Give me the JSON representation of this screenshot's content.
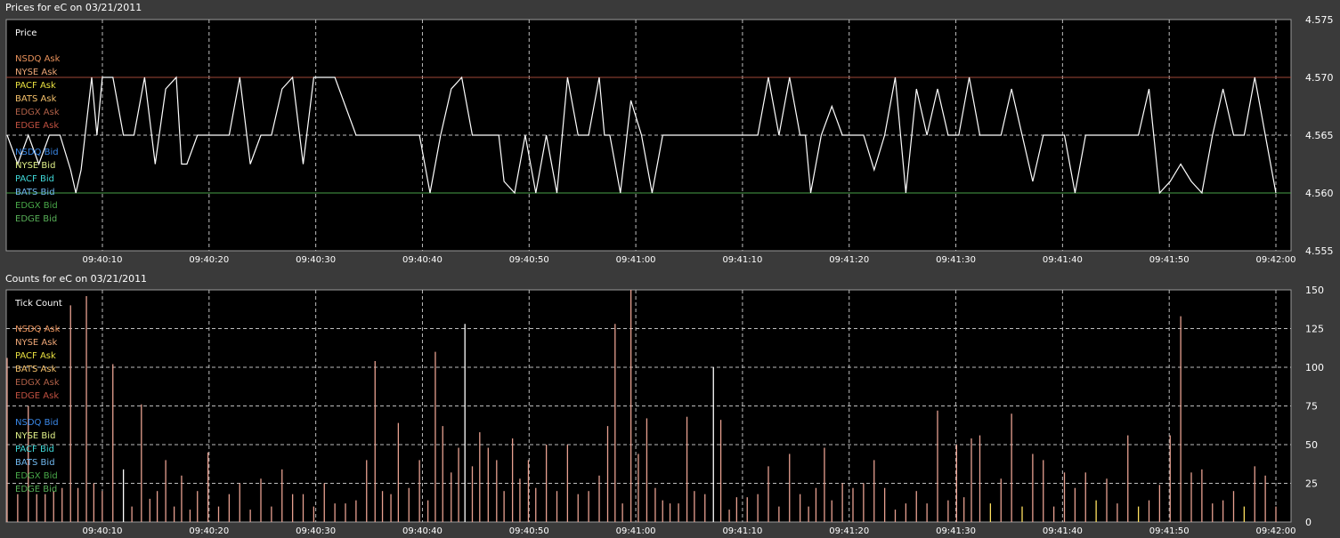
{
  "top_panel": {
    "title": "Prices for  eC  on  03/21/2011"
  },
  "bottom_panel": {
    "title": "Counts for  eC  on  03/21/2011"
  },
  "legend": [
    {
      "label": "NSDQ Ask",
      "color": "#e8915a"
    },
    {
      "label": "NYSE Ask",
      "color": "#f0a878"
    },
    {
      "label": "PACF Ask",
      "color": "#e8e040"
    },
    {
      "label": "BATS Ask",
      "color": "#f4c06a"
    },
    {
      "label": "EDGX Ask",
      "color": "#b06048"
    },
    {
      "label": "EDGE Ask",
      "color": "#c05040"
    },
    {
      "label": "NSDQ Bid",
      "color": "#3a88e8"
    },
    {
      "label": "NYSE Bid",
      "color": "#e0f088"
    },
    {
      "label": "PACF Bid",
      "color": "#40d8d8"
    },
    {
      "label": "BATS Bid",
      "color": "#70b8f0"
    },
    {
      "label": "EDGX Bid",
      "color": "#48a848"
    },
    {
      "label": "EDGE Bid",
      "color": "#58b058"
    }
  ],
  "chart_data": [
    {
      "type": "line",
      "title": "Prices for  eC  on  03/21/2011",
      "panel_label": "Price",
      "x_ticks": [
        "09:40:10",
        "09:40:20",
        "09:40:30",
        "09:40:40",
        "09:40:50",
        "09:41:00",
        "09:41:10",
        "09:41:20",
        "09:41:30",
        "09:41:40",
        "09:41:50",
        "09:42:00"
      ],
      "y_ticks": [
        "4.575",
        "4.570",
        "4.565",
        "4.560",
        "4.555"
      ],
      "x_range_seconds": [
        0,
        120
      ],
      "ylim": [
        4.555,
        4.575
      ],
      "grid": true,
      "legend_position": "left",
      "ask_line": {
        "value": 4.57,
        "color": "#a04838"
      },
      "bid_line": {
        "value": 4.56,
        "color": "#48a048"
      },
      "series": [
        {
          "color": "#ffffff",
          "x": [
            0,
            1,
            2,
            3,
            4,
            5,
            6,
            6.5,
            7,
            8,
            8.5,
            9,
            10,
            11,
            12,
            13,
            14,
            15,
            16,
            16.5,
            17,
            18,
            19,
            20,
            21,
            22,
            23,
            24,
            25,
            26,
            27,
            28,
            29,
            30,
            31,
            32,
            33,
            34,
            35,
            36,
            37,
            38,
            39,
            40,
            41,
            42,
            43,
            44,
            45,
            46,
            46.5,
            47,
            48,
            49,
            50,
            51,
            52,
            53,
            54,
            55,
            56,
            56.5,
            57,
            58,
            59,
            60,
            61,
            62,
            63,
            64,
            65,
            66,
            67,
            68,
            69,
            70,
            71,
            72,
            73,
            74,
            75,
            75.5,
            76,
            77,
            78,
            79,
            80,
            81,
            82,
            83,
            84,
            85,
            86,
            87,
            88,
            89,
            90,
            91,
            92,
            93,
            94,
            95,
            96,
            97,
            98,
            99,
            100,
            101,
            102,
            103,
            104,
            105,
            106,
            107,
            108,
            109,
            110,
            111,
            112,
            113,
            114,
            115,
            116,
            117,
            118,
            119,
            120
          ],
          "y": [
            4.565,
            4.5625,
            4.565,
            4.5625,
            4.565,
            4.565,
            4.562,
            4.56,
            4.562,
            4.57,
            4.565,
            4.57,
            4.57,
            4.565,
            4.565,
            4.57,
            4.5625,
            4.569,
            4.57,
            4.5625,
            4.5625,
            4.565,
            4.565,
            4.565,
            4.565,
            4.57,
            4.5625,
            4.565,
            4.565,
            4.569,
            4.57,
            4.5625,
            4.57,
            4.57,
            4.57,
            4.5675,
            4.565,
            4.565,
            4.565,
            4.565,
            4.565,
            4.565,
            4.565,
            4.56,
            4.565,
            4.569,
            4.57,
            4.565,
            4.565,
            4.565,
            4.565,
            4.561,
            4.56,
            4.565,
            4.56,
            4.565,
            4.56,
            4.57,
            4.565,
            4.565,
            4.57,
            4.565,
            4.565,
            4.56,
            4.568,
            4.565,
            4.56,
            4.565,
            4.565,
            4.565,
            4.565,
            4.565,
            4.565,
            4.565,
            4.565,
            4.565,
            4.565,
            4.57,
            4.565,
            4.57,
            4.565,
            4.565,
            4.56,
            4.565,
            4.5675,
            4.565,
            4.565,
            4.565,
            4.562,
            4.565,
            4.57,
            4.56,
            4.569,
            4.565,
            4.569,
            4.565,
            4.565,
            4.57,
            4.565,
            4.565,
            4.565,
            4.569,
            4.565,
            4.561,
            4.565,
            4.565,
            4.565,
            4.56,
            4.565,
            4.565,
            4.565,
            4.565,
            4.565,
            4.565,
            4.569,
            4.56,
            4.561,
            4.5625,
            4.561,
            4.56,
            4.565,
            4.569,
            4.565,
            4.565,
            4.57,
            4.565,
            4.56
          ]
        }
      ]
    },
    {
      "type": "bar",
      "title": "Counts for  eC  on  03/21/2011",
      "panel_label": "Tick Count",
      "x_ticks": [
        "09:40:10",
        "09:40:20",
        "09:40:30",
        "09:40:40",
        "09:40:50",
        "09:41:00",
        "09:41:10",
        "09:41:20",
        "09:41:30",
        "09:41:40",
        "09:41:50",
        "09:42:00"
      ],
      "y_ticks": [
        "150",
        "125",
        "100",
        "75",
        "50",
        "25",
        "0"
      ],
      "x_range_seconds": [
        0,
        120
      ],
      "ylim": [
        0,
        150
      ],
      "grid": true,
      "legend_position": "left",
      "bars": [
        {
          "x": 0.0,
          "v": 106,
          "c": "#e8a090"
        },
        {
          "x": 1.0,
          "v": 18,
          "c": "#e8a090"
        },
        {
          "x": 2.0,
          "v": 75,
          "c": "#e8a090"
        },
        {
          "x": 2.8,
          "v": 18,
          "c": "#e8a090"
        },
        {
          "x": 3.6,
          "v": 18,
          "c": "#e8a090"
        },
        {
          "x": 4.4,
          "v": 20,
          "c": "#e8a090"
        },
        {
          "x": 5.2,
          "v": 22,
          "c": "#e8a090"
        },
        {
          "x": 6.0,
          "v": 140,
          "c": "#e8a090"
        },
        {
          "x": 6.7,
          "v": 22,
          "c": "#e8a090"
        },
        {
          "x": 7.5,
          "v": 146,
          "c": "#e8a090"
        },
        {
          "x": 8.2,
          "v": 25,
          "c": "#e8a090"
        },
        {
          "x": 9.0,
          "v": 20,
          "c": "#e8a090"
        },
        {
          "x": 10.0,
          "v": 102,
          "c": "#e8a090"
        },
        {
          "x": 11.0,
          "v": 34,
          "c": "#ffffff"
        },
        {
          "x": 11.8,
          "v": 10,
          "c": "#e8a090"
        },
        {
          "x": 12.7,
          "v": 76,
          "c": "#e8a090"
        },
        {
          "x": 13.5,
          "v": 15,
          "c": "#e8a090"
        },
        {
          "x": 14.2,
          "v": 20,
          "c": "#e8a090"
        },
        {
          "x": 15.0,
          "v": 40,
          "c": "#e8a090"
        },
        {
          "x": 15.8,
          "v": 10,
          "c": "#e8a090"
        },
        {
          "x": 16.5,
          "v": 30,
          "c": "#e8a090"
        },
        {
          "x": 17.3,
          "v": 8,
          "c": "#e8a090"
        },
        {
          "x": 18.0,
          "v": 20,
          "c": "#e8a090"
        },
        {
          "x": 19.0,
          "v": 45,
          "c": "#e8a090"
        },
        {
          "x": 20.0,
          "v": 10,
          "c": "#e8a090"
        },
        {
          "x": 21.0,
          "v": 18,
          "c": "#e8a090"
        },
        {
          "x": 22.0,
          "v": 25,
          "c": "#e8a090"
        },
        {
          "x": 23.0,
          "v": 8,
          "c": "#e8a090"
        },
        {
          "x": 24.0,
          "v": 28,
          "c": "#e8a090"
        },
        {
          "x": 25.0,
          "v": 10,
          "c": "#e8a090"
        },
        {
          "x": 26.0,
          "v": 34,
          "c": "#e8a090"
        },
        {
          "x": 27.0,
          "v": 18,
          "c": "#e8a090"
        },
        {
          "x": 28.0,
          "v": 18,
          "c": "#e8a090"
        },
        {
          "x": 29.0,
          "v": 10,
          "c": "#e8a090"
        },
        {
          "x": 30.0,
          "v": 25,
          "c": "#e8a090"
        },
        {
          "x": 31.0,
          "v": 12,
          "c": "#e8a090"
        },
        {
          "x": 32.0,
          "v": 12,
          "c": "#e8a090"
        },
        {
          "x": 33.0,
          "v": 14,
          "c": "#e8a090"
        },
        {
          "x": 34.0,
          "v": 40,
          "c": "#e8a090"
        },
        {
          "x": 34.8,
          "v": 104,
          "c": "#e8a090"
        },
        {
          "x": 35.5,
          "v": 20,
          "c": "#e8a090"
        },
        {
          "x": 36.3,
          "v": 18,
          "c": "#e8a090"
        },
        {
          "x": 37.0,
          "v": 64,
          "c": "#e8a090"
        },
        {
          "x": 38.0,
          "v": 22,
          "c": "#e8a090"
        },
        {
          "x": 39.0,
          "v": 40,
          "c": "#e8a090"
        },
        {
          "x": 39.8,
          "v": 14,
          "c": "#e8a090"
        },
        {
          "x": 40.5,
          "v": 110,
          "c": "#e8a090"
        },
        {
          "x": 41.2,
          "v": 62,
          "c": "#e8a090"
        },
        {
          "x": 42.0,
          "v": 32,
          "c": "#e8a090"
        },
        {
          "x": 42.7,
          "v": 48,
          "c": "#e8a090"
        },
        {
          "x": 43.3,
          "v": 128,
          "c": "#ffffff"
        },
        {
          "x": 44.0,
          "v": 36,
          "c": "#e8a090"
        },
        {
          "x": 44.7,
          "v": 58,
          "c": "#e8a090"
        },
        {
          "x": 45.5,
          "v": 48,
          "c": "#e8a090"
        },
        {
          "x": 46.3,
          "v": 40,
          "c": "#e8a090"
        },
        {
          "x": 47.0,
          "v": 20,
          "c": "#e8a090"
        },
        {
          "x": 47.8,
          "v": 54,
          "c": "#e8a090"
        },
        {
          "x": 48.5,
          "v": 28,
          "c": "#e8a090"
        },
        {
          "x": 49.3,
          "v": 40,
          "c": "#e8a090"
        },
        {
          "x": 50.0,
          "v": 22,
          "c": "#e8a090"
        },
        {
          "x": 51.0,
          "v": 50,
          "c": "#e8a090"
        },
        {
          "x": 52.0,
          "v": 20,
          "c": "#e8a090"
        },
        {
          "x": 53.0,
          "v": 50,
          "c": "#e8a090"
        },
        {
          "x": 54.0,
          "v": 18,
          "c": "#e8a090"
        },
        {
          "x": 55.0,
          "v": 20,
          "c": "#e8a090"
        },
        {
          "x": 56.0,
          "v": 30,
          "c": "#e8a090"
        },
        {
          "x": 56.8,
          "v": 62,
          "c": "#e8a090"
        },
        {
          "x": 57.5,
          "v": 128,
          "c": "#e8a090"
        },
        {
          "x": 58.2,
          "v": 12,
          "c": "#e8a090"
        },
        {
          "x": 59.0,
          "v": 150,
          "c": "#e8a090"
        },
        {
          "x": 59.7,
          "v": 44,
          "c": "#e8a090"
        },
        {
          "x": 60.5,
          "v": 67,
          "c": "#e8a090"
        },
        {
          "x": 61.3,
          "v": 22,
          "c": "#e8a090"
        },
        {
          "x": 62.0,
          "v": 14,
          "c": "#e8a090"
        },
        {
          "x": 62.7,
          "v": 12,
          "c": "#e8a090"
        },
        {
          "x": 63.5,
          "v": 12,
          "c": "#e8a090"
        },
        {
          "x": 64.3,
          "v": 68,
          "c": "#e8a090"
        },
        {
          "x": 65.0,
          "v": 20,
          "c": "#e8a090"
        },
        {
          "x": 66.0,
          "v": 18,
          "c": "#e8a090"
        },
        {
          "x": 66.8,
          "v": 100,
          "c": "#ffffff"
        },
        {
          "x": 67.5,
          "v": 66,
          "c": "#e8a090"
        },
        {
          "x": 68.3,
          "v": 8,
          "c": "#e8a090"
        },
        {
          "x": 69.0,
          "v": 16,
          "c": "#e8a090"
        },
        {
          "x": 70.0,
          "v": 16,
          "c": "#e8a090"
        },
        {
          "x": 71.0,
          "v": 18,
          "c": "#e8a090"
        },
        {
          "x": 72.0,
          "v": 36,
          "c": "#e8a090"
        },
        {
          "x": 73.0,
          "v": 10,
          "c": "#e8a090"
        },
        {
          "x": 74.0,
          "v": 44,
          "c": "#e8a090"
        },
        {
          "x": 75.0,
          "v": 18,
          "c": "#e8a090"
        },
        {
          "x": 75.8,
          "v": 10,
          "c": "#e8a090"
        },
        {
          "x": 76.5,
          "v": 22,
          "c": "#e8a090"
        },
        {
          "x": 77.3,
          "v": 48,
          "c": "#e8a090"
        },
        {
          "x": 78.0,
          "v": 14,
          "c": "#e8a090"
        },
        {
          "x": 79.0,
          "v": 25,
          "c": "#e8a090"
        },
        {
          "x": 80.0,
          "v": 22,
          "c": "#e8a090"
        },
        {
          "x": 81.0,
          "v": 25,
          "c": "#e8a090"
        },
        {
          "x": 82.0,
          "v": 40,
          "c": "#e8a090"
        },
        {
          "x": 83.0,
          "v": 22,
          "c": "#e8a090"
        },
        {
          "x": 84.0,
          "v": 8,
          "c": "#e8a090"
        },
        {
          "x": 85.0,
          "v": 12,
          "c": "#e8a090"
        },
        {
          "x": 86.0,
          "v": 20,
          "c": "#e8a090"
        },
        {
          "x": 87.0,
          "v": 12,
          "c": "#e8a090"
        },
        {
          "x": 88.0,
          "v": 72,
          "c": "#e8a090"
        },
        {
          "x": 89.0,
          "v": 14,
          "c": "#e8a090"
        },
        {
          "x": 89.8,
          "v": 50,
          "c": "#e8a090"
        },
        {
          "x": 90.5,
          "v": 16,
          "c": "#e8a090"
        },
        {
          "x": 91.2,
          "v": 54,
          "c": "#e8a090"
        },
        {
          "x": 92.0,
          "v": 56,
          "c": "#e8a090"
        },
        {
          "x": 93.0,
          "v": 12,
          "c": "#ffe060"
        },
        {
          "x": 94.0,
          "v": 28,
          "c": "#e8a090"
        },
        {
          "x": 95.0,
          "v": 70,
          "c": "#e8a090"
        },
        {
          "x": 96.0,
          "v": 10,
          "c": "#ffe060"
        },
        {
          "x": 97.0,
          "v": 44,
          "c": "#e8a090"
        },
        {
          "x": 98.0,
          "v": 40,
          "c": "#e8a090"
        },
        {
          "x": 99.0,
          "v": 10,
          "c": "#e8a090"
        },
        {
          "x": 100.0,
          "v": 32,
          "c": "#e8a090"
        },
        {
          "x": 101.0,
          "v": 22,
          "c": "#e8a090"
        },
        {
          "x": 102.0,
          "v": 32,
          "c": "#e8a090"
        },
        {
          "x": 103.0,
          "v": 14,
          "c": "#ffe060"
        },
        {
          "x": 104.0,
          "v": 28,
          "c": "#e8a090"
        },
        {
          "x": 105.0,
          "v": 12,
          "c": "#e8a090"
        },
        {
          "x": 106.0,
          "v": 56,
          "c": "#e8a090"
        },
        {
          "x": 107.0,
          "v": 10,
          "c": "#ffe060"
        },
        {
          "x": 108.0,
          "v": 14,
          "c": "#e8a090"
        },
        {
          "x": 109.0,
          "v": 24,
          "c": "#e8a090"
        },
        {
          "x": 110.0,
          "v": 56,
          "c": "#e8a090"
        },
        {
          "x": 111.0,
          "v": 133,
          "c": "#e8a090"
        },
        {
          "x": 112.0,
          "v": 32,
          "c": "#e8a090"
        },
        {
          "x": 113.0,
          "v": 34,
          "c": "#e8a090"
        },
        {
          "x": 114.0,
          "v": 12,
          "c": "#e8a090"
        },
        {
          "x": 115.0,
          "v": 14,
          "c": "#e8a090"
        },
        {
          "x": 116.0,
          "v": 20,
          "c": "#e8a090"
        },
        {
          "x": 117.0,
          "v": 10,
          "c": "#ffe060"
        },
        {
          "x": 118.0,
          "v": 36,
          "c": "#e8a090"
        },
        {
          "x": 119.0,
          "v": 30,
          "c": "#e8a090"
        },
        {
          "x": 120.0,
          "v": 10,
          "c": "#e8a090"
        }
      ]
    }
  ]
}
